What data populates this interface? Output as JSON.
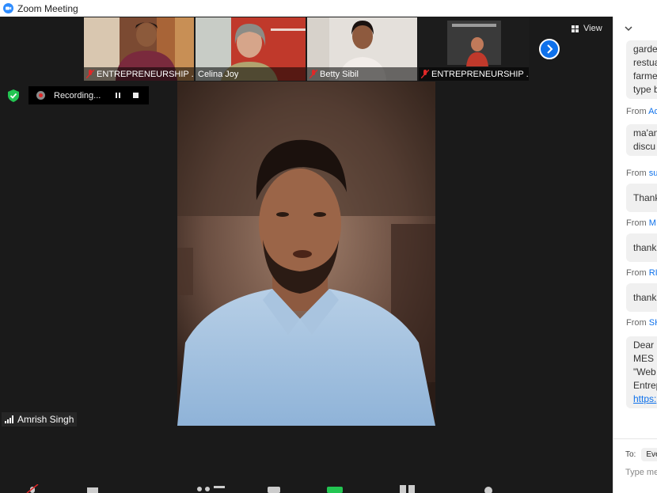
{
  "window": {
    "title": "Zoom Meeting"
  },
  "participants": [
    {
      "name": "ENTREPRENEURSHIP ...",
      "muted": true
    },
    {
      "name": "Celina Joy",
      "muted": false
    },
    {
      "name": "Betty Sibil",
      "muted": true
    },
    {
      "name": "ENTREPRENEURSHIP ...",
      "muted": true
    }
  ],
  "view_button": {
    "label": "View",
    "icon": "grid-icon"
  },
  "recording": {
    "label": "Recording...",
    "pause_icon": "pause-icon",
    "stop_icon": "stop-icon"
  },
  "active_speaker": {
    "name": "Amrish Singh",
    "icon": "signal-bars-icon"
  },
  "chat": {
    "messages": [
      {
        "from": "",
        "sender": "",
        "lines": [
          "garde",
          "restua",
          "farme",
          "type b"
        ]
      },
      {
        "from": "From",
        "sender": "Ad",
        "lines": [
          "ma'an",
          "discu"
        ]
      },
      {
        "from": "From",
        "sender": "su",
        "lines": [
          "Thank"
        ]
      },
      {
        "from": "From",
        "sender": "M",
        "lines": [
          "thank"
        ]
      },
      {
        "from": "From",
        "sender": "RI",
        "lines": [
          "thank"
        ]
      },
      {
        "from": "From",
        "sender": "SH",
        "lines": [
          "Dear",
          "MES I",
          "\"Web",
          "Entrep",
          "https:"
        ]
      }
    ],
    "to_label": "To:",
    "to_value": "Eve",
    "input_placeholder": "Type me"
  },
  "colors": {
    "accent": "#0e71eb",
    "record": "#e02828",
    "secure": "#23c552"
  }
}
